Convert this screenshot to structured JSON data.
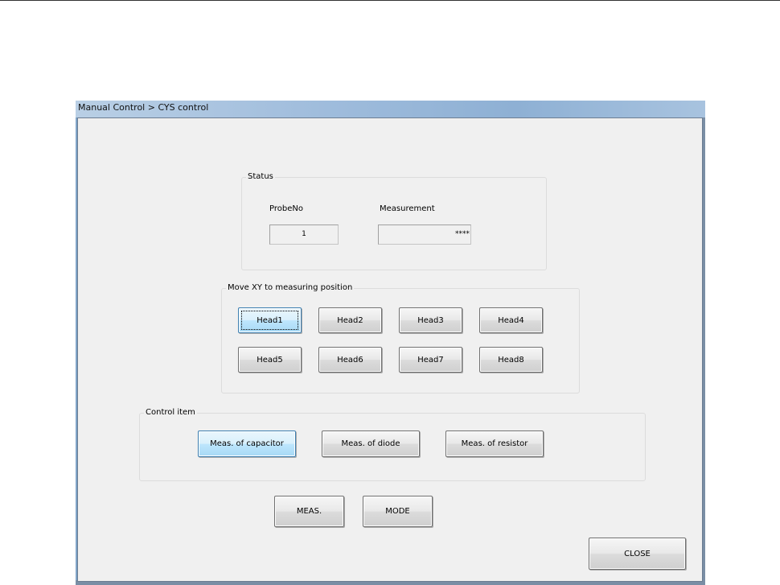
{
  "window": {
    "title": "Manual Control > CYS control"
  },
  "status": {
    "group_label": "Status",
    "probe_label": "ProbeNo",
    "probe_value": "1",
    "measurement_label": "Measurement",
    "measurement_value": "****"
  },
  "move_xy": {
    "group_label": "Move XY to measuring position",
    "heads": [
      "Head1",
      "Head2",
      "Head3",
      "Head4",
      "Head5",
      "Head6",
      "Head7",
      "Head8"
    ]
  },
  "control_item": {
    "group_label": "Control item",
    "buttons": [
      "Meas. of capacitor",
      "Meas. of diode",
      "Meas. of resistor"
    ]
  },
  "actions": {
    "meas_label": "MEAS.",
    "mode_label": "MODE",
    "close_label": "CLOSE"
  },
  "colors": {
    "selected_button": "#bee6fd",
    "title_bar": "#9fbcdc",
    "client_bg": "#f0f0f0"
  }
}
